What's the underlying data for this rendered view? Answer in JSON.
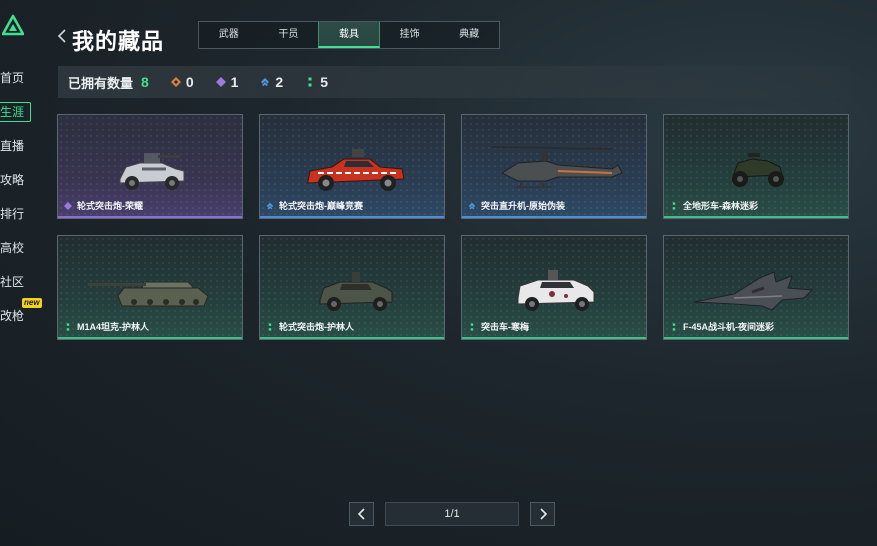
{
  "sidebar": {
    "items": [
      {
        "label": "首页"
      },
      {
        "label": "生涯"
      },
      {
        "label": "直播"
      },
      {
        "label": "攻略"
      },
      {
        "label": "排行"
      },
      {
        "label": "高校"
      },
      {
        "label": "社区"
      },
      {
        "label": "改枪",
        "badge": "new"
      }
    ],
    "active_index": 1
  },
  "header": {
    "title": "我的藏品",
    "tabs": [
      "武器",
      "干员",
      "载具",
      "挂饰",
      "典藏"
    ],
    "active_tab": "载具"
  },
  "stats": {
    "owned_label": "已拥有数量",
    "owned_count": "8",
    "by_rarity": [
      {
        "rarity": "orange",
        "color": "#e0803a",
        "count": "0"
      },
      {
        "rarity": "purple",
        "color": "#9b7be0",
        "count": "1"
      },
      {
        "rarity": "blue",
        "color": "#4f9be0",
        "count": "2"
      },
      {
        "rarity": "green",
        "color": "#3fe08f",
        "count": "5"
      }
    ]
  },
  "vehicles": [
    {
      "name": "轮式突击炮-荣耀",
      "rarity": "purple",
      "icon": "humvee-icon"
    },
    {
      "name": "轮式突击炮-巅峰竞赛",
      "rarity": "blue",
      "icon": "race-truck-icon"
    },
    {
      "name": "突击直升机-原始伪装",
      "rarity": "blue",
      "icon": "helicopter-icon"
    },
    {
      "name": "全地形车-森林迷彩",
      "rarity": "green",
      "icon": "atv-icon"
    },
    {
      "name": "M1A4坦克-护林人",
      "rarity": "green",
      "icon": "tank-icon"
    },
    {
      "name": "轮式突击炮-护林人",
      "rarity": "green",
      "icon": "armored-car-icon"
    },
    {
      "name": "突击车-寒梅",
      "rarity": "green",
      "icon": "assault-vehicle-icon"
    },
    {
      "name": "F-45A战斗机-夜间迷彩",
      "rarity": "green",
      "icon": "fighter-jet-icon"
    }
  ],
  "pager": {
    "text": "1/1"
  }
}
